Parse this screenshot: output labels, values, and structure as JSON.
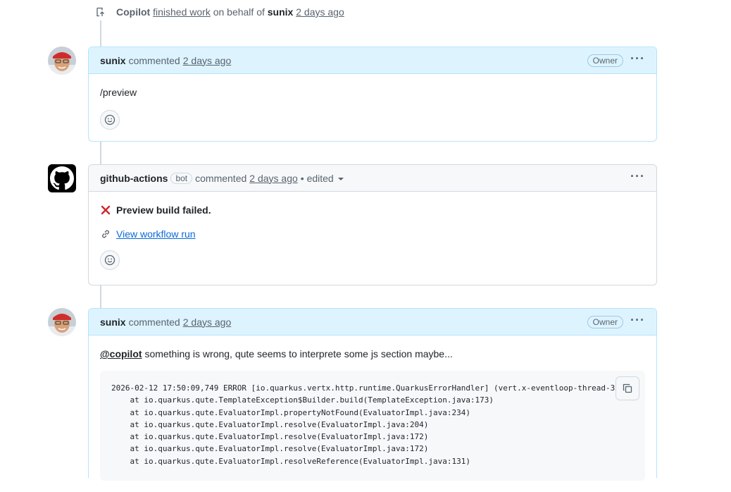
{
  "event": {
    "actor": "Copilot",
    "action": "finished work",
    "on_behalf": "on behalf of",
    "user": "sunix",
    "time": "2 days ago"
  },
  "comments": [
    {
      "author": "sunix",
      "verb": "commented",
      "time": "2 days ago",
      "badge": "Owner",
      "body": "/preview"
    },
    {
      "author": "github-actions",
      "bot_label": "bot",
      "verb": "commented",
      "time": "2 days ago",
      "edited": "• edited",
      "status_text": "Preview build failed.",
      "link_text": "View workflow run"
    },
    {
      "author": "sunix",
      "verb": "commented",
      "time": "2 days ago",
      "badge": "Owner",
      "mention": "@copilot",
      "body": "something is wrong, qute seems to interprete some js section maybe...",
      "code": "2026-02-12 17:50:09,749 ERROR [io.quarkus.vertx.http.runtime.QuarkusErrorHandler] (vert.x-eventloop-thread-3) R\n    at io.quarkus.qute.TemplateException$Builder.build(TemplateException.java:173)\n    at io.quarkus.qute.EvaluatorImpl.propertyNotFound(EvaluatorImpl.java:234)\n    at io.quarkus.qute.EvaluatorImpl.resolve(EvaluatorImpl.java:204)\n    at io.quarkus.qute.EvaluatorImpl.resolve(EvaluatorImpl.java:172)\n    at io.quarkus.qute.EvaluatorImpl.resolve(EvaluatorImpl.java:172)\n    at io.quarkus.qute.EvaluatorImpl.resolveReference(EvaluatorImpl.java:131)"
    }
  ],
  "icons": {
    "event": "copilot-push-icon",
    "menu": "kebab-horizontal-icon",
    "reaction": "smiley-icon",
    "status": "x-icon",
    "link": "link-icon",
    "copy": "copy-icon"
  },
  "colors": {
    "owner_header": "#ddf4ff",
    "owner_border": "#b6e3ff",
    "link": "#0969da",
    "error": "#d1242f"
  }
}
